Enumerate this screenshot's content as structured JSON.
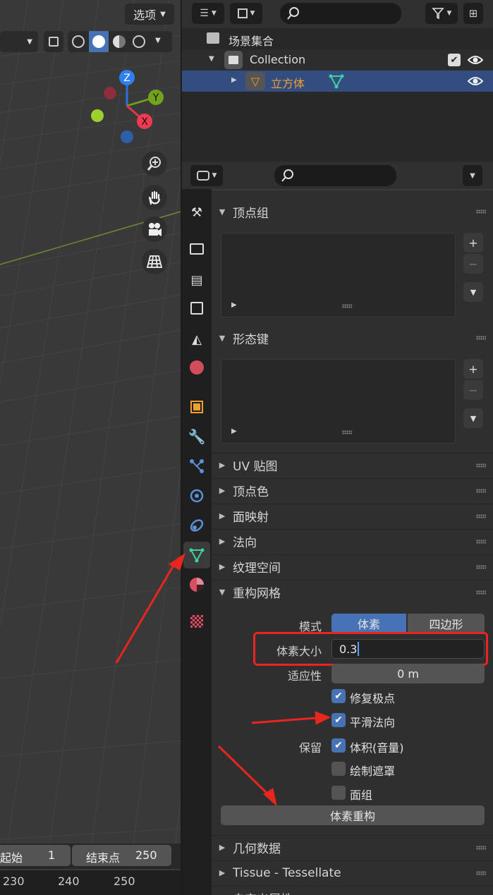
{
  "viewport": {
    "options_label": "选项",
    "gizmo_axes": {
      "z": "Z",
      "y": "Y",
      "x": "X"
    },
    "timeline": {
      "start_label": "起始",
      "start_value": "1",
      "end_label": "结束点",
      "end_value": "250",
      "ticks": [
        "230",
        "240",
        "250"
      ]
    }
  },
  "outliner": {
    "scene_collection": "场景集合",
    "collection": "Collection",
    "object": "立方体"
  },
  "properties": {
    "panels": {
      "vertex_groups": "顶点组",
      "shape_keys": "形态键",
      "uv_maps": "UV 贴图",
      "vertex_colors": "顶点色",
      "face_maps": "面映射",
      "normals": "法向",
      "texture_space": "纹理空间",
      "remesh": "重构网格",
      "geometry_data": "几何数据",
      "tissue": "Tissue - Tessellate",
      "custom_props": "自定义属性"
    },
    "remesh": {
      "mode_label": "模式",
      "mode_voxel": "体素",
      "mode_quad": "四边形",
      "voxel_size_label": "体素大小",
      "voxel_size_value": "0.3",
      "adaptivity_label": "适应性",
      "adaptivity_value": "0 m",
      "fix_poles": "修复极点",
      "smooth_normals": "平滑法向",
      "preserve_label": "保留",
      "volume": "体积(音量)",
      "paint_mask": "绘制遮罩",
      "face_sets": "面组",
      "voxel_remesh_button": "体素重构"
    }
  },
  "colors": {
    "accent": "#4772b3",
    "annotation": "#e8261e",
    "object_orange": "#f0a030",
    "mesh_teal": "#3fcfa0"
  }
}
